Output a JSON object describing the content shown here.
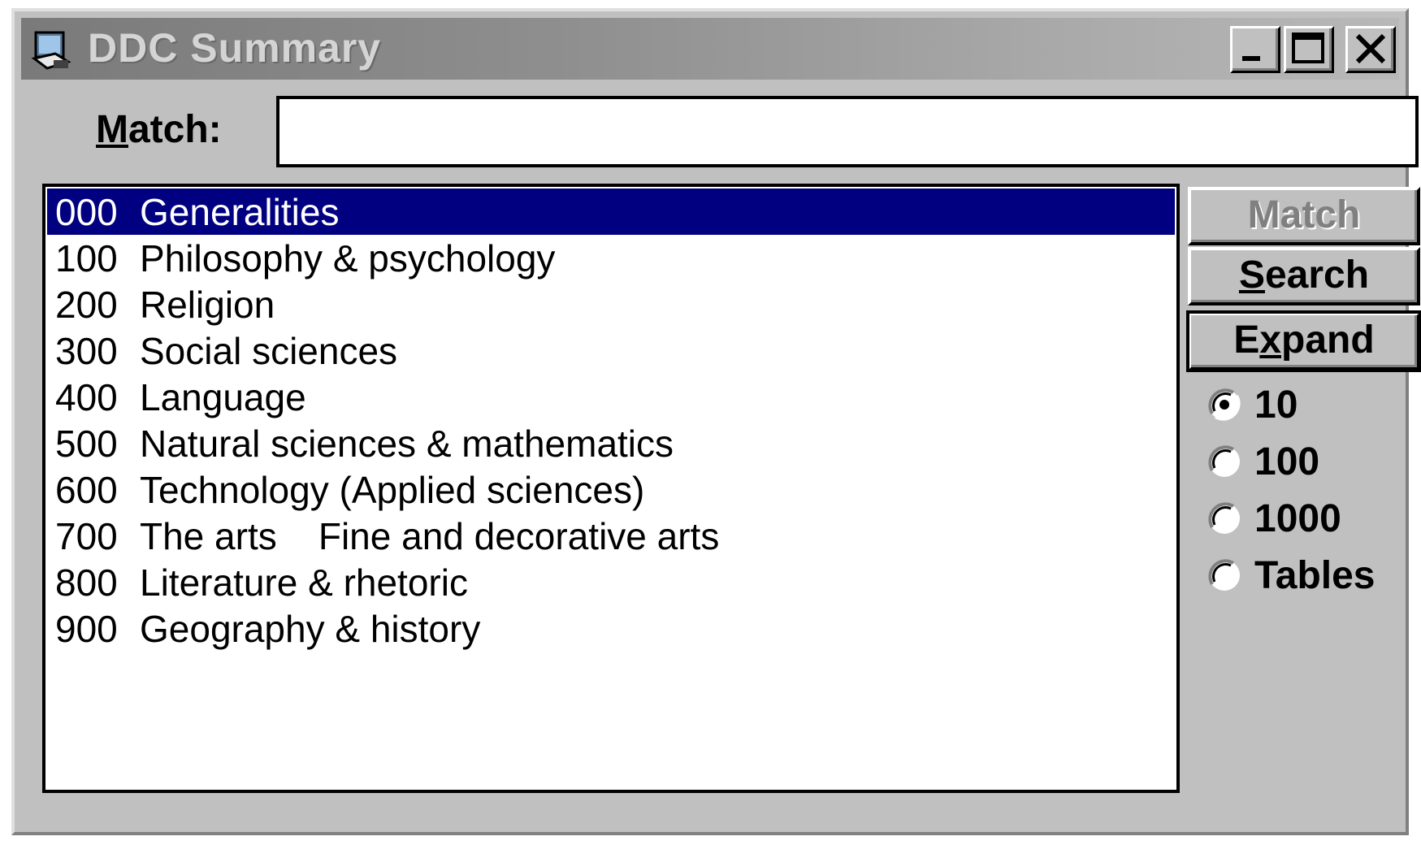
{
  "window": {
    "title": "DDC Summary"
  },
  "match": {
    "label_prefix": "M",
    "label_rest": "atch:",
    "value": ""
  },
  "list": {
    "items": [
      {
        "code": "000",
        "label": "Generalities",
        "selected": true
      },
      {
        "code": "100",
        "label": "Philosophy & psychology"
      },
      {
        "code": "200",
        "label": "Religion"
      },
      {
        "code": "300",
        "label": "Social sciences"
      },
      {
        "code": "400",
        "label": "Language"
      },
      {
        "code": "500",
        "label": "Natural sciences & mathematics"
      },
      {
        "code": "600",
        "label": "Technology (Applied sciences)"
      },
      {
        "code": "700",
        "label": "The arts    Fine and decorative arts"
      },
      {
        "code": "800",
        "label": "Literature & rhetoric"
      },
      {
        "code": "900",
        "label": "Geography & history"
      }
    ]
  },
  "buttons": {
    "match": "Match",
    "search_u": "S",
    "search_rest": "earch",
    "expand_a": "E",
    "expand_u": "x",
    "expand_rest": "pand"
  },
  "radios": {
    "r10": "10",
    "r100": "100",
    "r1000": "1000",
    "tables": "Tables",
    "selected": "10"
  },
  "colors": {
    "selection": "#000080",
    "face": "#c0c0c0"
  },
  "icons": {
    "app": "ddc-app-icon",
    "minimize": "minimize-icon",
    "maximize": "maximize-icon",
    "close": "close-icon",
    "radio_selected": "radio-selected-icon",
    "radio_unselected": "radio-unselected-icon"
  }
}
